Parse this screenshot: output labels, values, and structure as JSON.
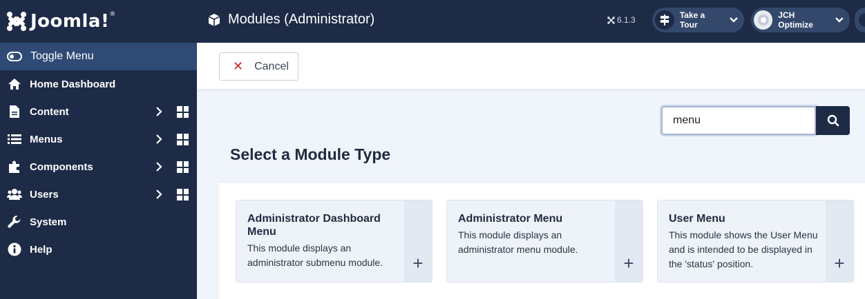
{
  "brand": {
    "name": "Joomla!",
    "trademark": "®"
  },
  "sidebar": {
    "toggle_label": "Toggle Menu",
    "items": [
      {
        "label": "Home Dashboard",
        "icon": "home-icon"
      },
      {
        "label": "Content",
        "icon": "file-icon"
      },
      {
        "label": "Menus",
        "icon": "list-icon"
      },
      {
        "label": "Components",
        "icon": "puzzle-icon"
      },
      {
        "label": "Users",
        "icon": "users-icon"
      },
      {
        "label": "System",
        "icon": "wrench-icon"
      },
      {
        "label": "Help",
        "icon": "info-icon"
      }
    ]
  },
  "header": {
    "title": "Modules (Administrator)",
    "version": "6.1.3",
    "tour_label": "Take a Tour",
    "plugin_label": "JCH Optimize"
  },
  "toolbar": {
    "cancel_label": "Cancel"
  },
  "search": {
    "value": "menu"
  },
  "main": {
    "section_title": "Select a Module Type",
    "modules": [
      {
        "name": "Administrator Dashboard Menu",
        "description": "This module displays an administrator submenu module."
      },
      {
        "name": "Administrator Menu",
        "description": "This module displays an administrator menu module."
      },
      {
        "name": "User Menu",
        "description": "This module shows the User Menu and is intended to be displayed in the 'status' position."
      }
    ],
    "add_symbol": "+"
  },
  "colors": {
    "sidebar_bg": "#1d2b47",
    "toggle_bg": "#2f4a75",
    "cancel_x": "#c52828",
    "page_bg": "#f0f4fb"
  }
}
